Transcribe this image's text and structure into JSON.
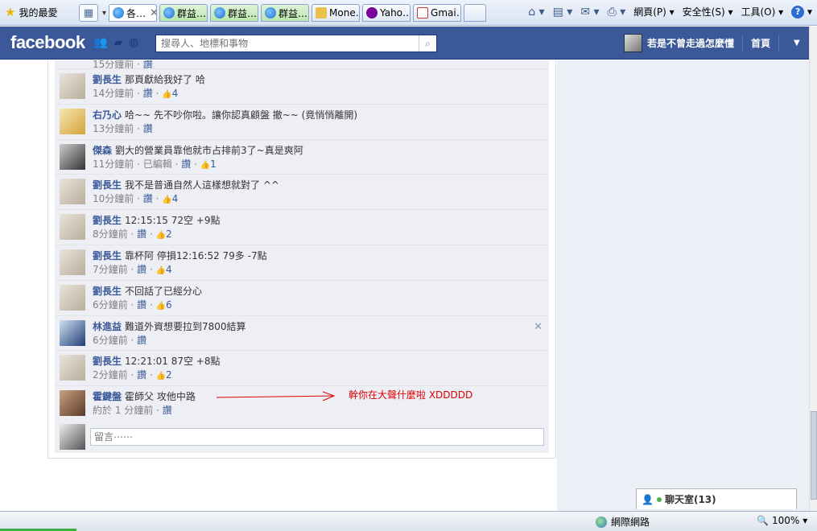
{
  "browser": {
    "favorites_label": "我的最愛",
    "tabs": [
      {
        "label": "各…",
        "icon": "ie-page-icon",
        "active": true
      },
      {
        "label": "群益…",
        "icon": "ie-page-icon"
      },
      {
        "label": "群益…",
        "icon": "ie-page-icon"
      },
      {
        "label": "群益…",
        "icon": "ie-page-icon"
      },
      {
        "label": "Mone…",
        "icon": "dj-icon"
      },
      {
        "label": "Yaho…",
        "icon": "yahoo-icon"
      },
      {
        "label": "Gmai…",
        "icon": "gmail-icon"
      }
    ],
    "menu": {
      "page": "網頁(P)",
      "safety": "安全性(S)",
      "tools": "工具(O)"
    }
  },
  "header": {
    "logo": "facebook",
    "search_placeholder": "搜尋人、地標和事物",
    "user_name": "若是不曾走過怎麼懂",
    "home": "首頁"
  },
  "comments": [
    {
      "name": "劉長生",
      "text": "那頁獻給我好了 哈",
      "time": "14分鐘前",
      "like_label": "讚",
      "likes": "4",
      "avatar": "liu"
    },
    {
      "name": "右乃心",
      "text": "哈~~ 先不吵你啦。讓你認真顧盤  撤~~ (竟悄悄離開)",
      "time": "13分鐘前",
      "like_label": "讚",
      "likes": "",
      "avatar": "you"
    },
    {
      "name": "傑森",
      "text": "劉大的營業員靠他就市占排前3了~真是爽阿",
      "time": "11分鐘前",
      "edited": "已編輯",
      "like_label": "讚",
      "likes": "1",
      "avatar": "jie"
    },
    {
      "name": "劉長生",
      "text": "我不是普通自然人這樣想就對了 ^^",
      "time": "10分鐘前",
      "like_label": "讚",
      "likes": "4",
      "avatar": "liu"
    },
    {
      "name": "劉長生",
      "text": "12:15:15 72空 +9點",
      "time": "8分鐘前",
      "like_label": "讚",
      "likes": "2",
      "avatar": "liu"
    },
    {
      "name": "劉長生",
      "text": "靠杯阿 停損12:16:52 79多 -7點",
      "time": "7分鐘前",
      "like_label": "讚",
      "likes": "4",
      "avatar": "liu"
    },
    {
      "name": "劉長生",
      "text": "不回話了已經分心",
      "time": "6分鐘前",
      "like_label": "讚",
      "likes": "6",
      "avatar": "liu"
    },
    {
      "name": "林進益",
      "text": "難道外資想要拉到7800結算",
      "time": "6分鐘前",
      "like_label": "讚",
      "likes": "",
      "avatar": "lin",
      "removable": true
    },
    {
      "name": "劉長生",
      "text": "12:21:01 87空 +8點",
      "time": "2分鐘前",
      "like_label": "讚",
      "likes": "2",
      "avatar": "liu"
    },
    {
      "name": "霍鍵盤",
      "text": "霍師父 攻他中路",
      "time": "約於 1 分鐘前",
      "like_label": "讚",
      "likes": "",
      "avatar": "huo"
    }
  ],
  "partial_comment": {
    "time": "15分鐘前",
    "like_label": "讚"
  },
  "compose": {
    "placeholder": "留言⋯⋯"
  },
  "annotation": "幹你在大聲什麼啦 XDDDDD",
  "chat": {
    "label": "聊天室(13)"
  },
  "status": {
    "zone": "網際網路",
    "zoom": "100%"
  }
}
